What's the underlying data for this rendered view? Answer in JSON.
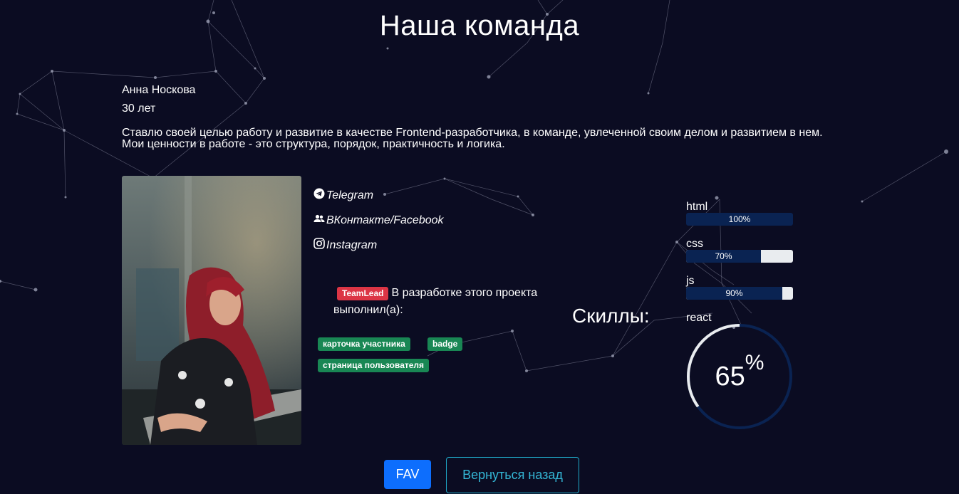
{
  "page": {
    "title": "Наша команда"
  },
  "member": {
    "name": "Анна Носкова",
    "age": "30 лет",
    "bio": "Ставлю своей целью работу и развитие в качестве Frontend-разработчика, в команде, увлеченной своим делом и развитием в нем. Мои ценности в работе - это структура, порядок, практичность и логика."
  },
  "social": {
    "telegram": {
      "label": "Telegram",
      "icon": "telegram-icon"
    },
    "vk": {
      "label": "ВКонтакте/Facebook",
      "icon": "users-icon"
    },
    "instagram": {
      "label": "Instagram",
      "icon": "instagram-icon"
    }
  },
  "role": {
    "badge": "TeamLead",
    "text": "В разработке этого проекта выполнил(а):",
    "tasks": [
      "карточка участника",
      "badge",
      "страница пользователя"
    ]
  },
  "skills": {
    "title": "Скиллы:",
    "items": [
      {
        "name": "html",
        "value": 100,
        "label": "100%"
      },
      {
        "name": "css",
        "value": 70,
        "label": "70%"
      },
      {
        "name": "js",
        "value": 90,
        "label": "90%"
      }
    ],
    "react": {
      "name": "react",
      "value": 65,
      "number": "65",
      "percent": "%"
    }
  },
  "buttons": {
    "fav": "FAV",
    "back": "Вернуться назад"
  },
  "colors": {
    "background": "#0b0c22",
    "bar_fill": "#0a2352",
    "bar_track": "#e9ecef",
    "badge_red": "#dc3545",
    "badge_green": "#198754",
    "fav_button": "#0d6efd",
    "back_button_border": "#1fa9c8"
  }
}
